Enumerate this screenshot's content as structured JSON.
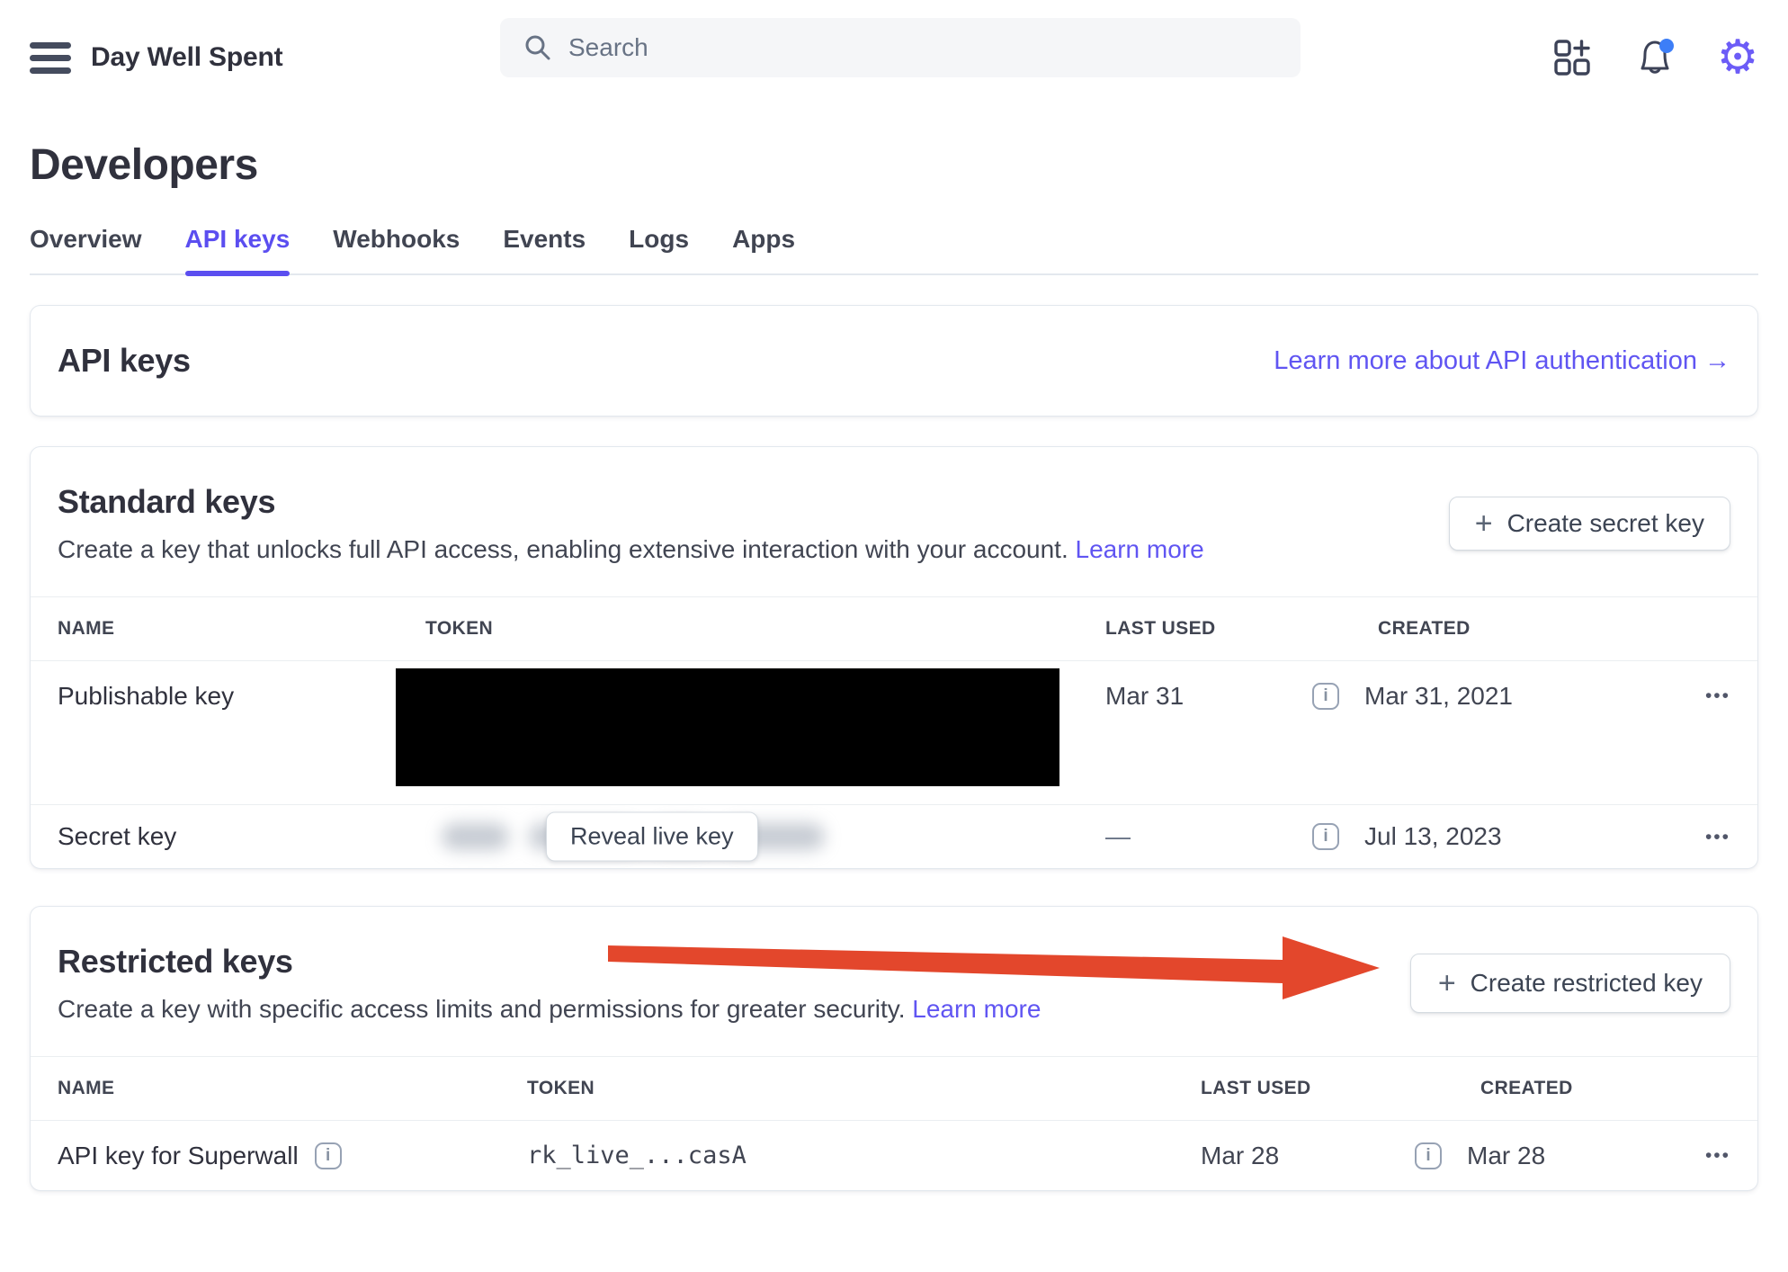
{
  "colors": {
    "accent": "#5b4ef0",
    "link": "#6055f2",
    "arrow_red": "#e3472c",
    "notification_blue": "#3d7ef7"
  },
  "icons": {
    "plus": "+",
    "overflow": "•••",
    "info": "i",
    "arrow_right": "→",
    "gear": "⚙"
  },
  "header": {
    "brand": "Day Well Spent",
    "search_placeholder": "Search"
  },
  "page": {
    "title": "Developers"
  },
  "tabs": [
    {
      "label": "Overview"
    },
    {
      "label": "API keys"
    },
    {
      "label": "Webhooks"
    },
    {
      "label": "Events"
    },
    {
      "label": "Logs"
    },
    {
      "label": "Apps"
    }
  ],
  "api_keys_card": {
    "title": "API keys",
    "link": "Learn more about API authentication"
  },
  "standard_keys": {
    "title": "Standard keys",
    "description": "Create a key that unlocks full API access, enabling extensive interaction with your account.",
    "learn_more": "Learn more",
    "create_button": "Create secret key",
    "columns": [
      "NAME",
      "TOKEN",
      "LAST USED",
      "CREATED"
    ],
    "rows": [
      {
        "name": "Publishable key",
        "token_state": "redacted",
        "last_used": "Mar 31",
        "created": "Mar 31, 2021"
      },
      {
        "name": "Secret key",
        "token_state": "hidden-blurred",
        "reveal_button": "Reveal live key",
        "last_used": "—",
        "created": "Jul 13, 2023"
      }
    ]
  },
  "restricted_keys": {
    "title": "Restricted keys",
    "description": "Create a key with specific access limits and permissions for greater security.",
    "learn_more": "Learn more",
    "create_button": "Create restricted key",
    "columns": [
      "NAME",
      "TOKEN",
      "LAST USED",
      "CREATED"
    ],
    "rows": [
      {
        "name": "API key for Superwall",
        "token": "rk_live_...casA",
        "last_used": "Mar 28",
        "created": "Mar 28"
      }
    ]
  }
}
